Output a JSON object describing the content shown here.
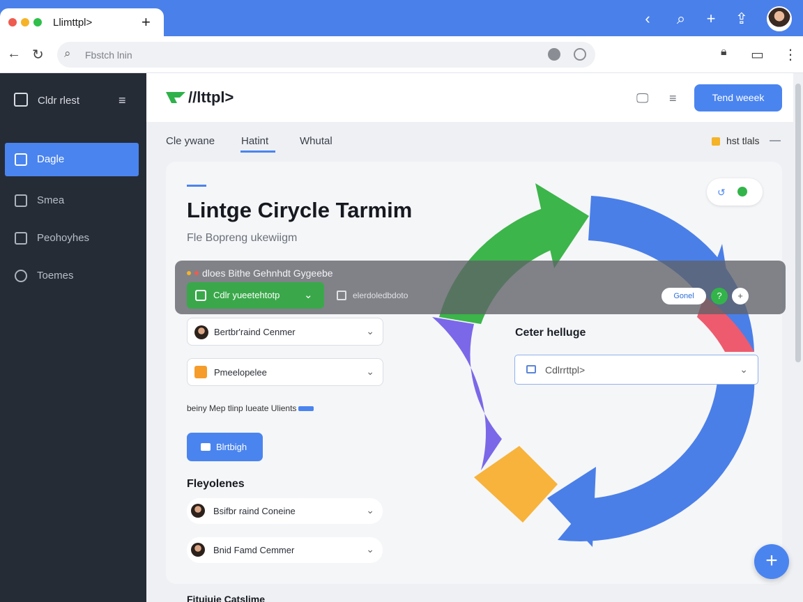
{
  "browser": {
    "tab_title": "Llimttpl>",
    "tab_plus": "+",
    "address_placeholder": "Fbstch lnin"
  },
  "sidebar": {
    "title": "Cldr rlest",
    "items": [
      {
        "label": "Dagle",
        "active": true
      },
      {
        "label": "Smea",
        "active": false
      },
      {
        "label": "Peohoyhes",
        "active": false
      },
      {
        "label": "Toemes",
        "active": false
      }
    ]
  },
  "header": {
    "logo_text": "//lttpl>",
    "primary_button": "Tend weeek"
  },
  "tabs": [
    "Cle ywane",
    "Hatint",
    "Whutal"
  ],
  "header_badge": "hst tlals",
  "main": {
    "title": "Lintge Cirycle Tarmim",
    "subtitle": "Fle Bopreng ukewiigm"
  },
  "band": {
    "title": "dloes Bithe Gehnhdt Gygeebe",
    "green_dropdown": "Cdlr yueetehtotp",
    "middle_text": "elerdoledbdoto",
    "pill_label": "Gonel",
    "circle_a": "?",
    "circle_b": "+"
  },
  "fields": [
    {
      "label": "Bertbr'raind Cenmer"
    },
    {
      "label": "Pmeelopelee"
    }
  ],
  "hint_text": "beiny Mep tlinp Iueate Ulients",
  "action_button": "Blrtbigh",
  "section_title": "Fleyolenes",
  "rows": [
    {
      "label": "Bsifbr raind Coneine"
    },
    {
      "label": "Bnid Famd Cemmer"
    }
  ],
  "center_label": "Ceter helluge",
  "select_value": "Cdlrrttpl>",
  "fab": "+",
  "footer_text": "Fituiuie Catslime",
  "colors": {
    "accent": "#4a84ef",
    "sidebar": "#262c36",
    "green": "#3aa84a",
    "cycle_green": "#3cb54a",
    "cycle_blue": "#4a7fe8",
    "cycle_red": "#ee5b6e",
    "cycle_purple": "#7a68e8",
    "cycle_orange": "#f7b33b"
  }
}
